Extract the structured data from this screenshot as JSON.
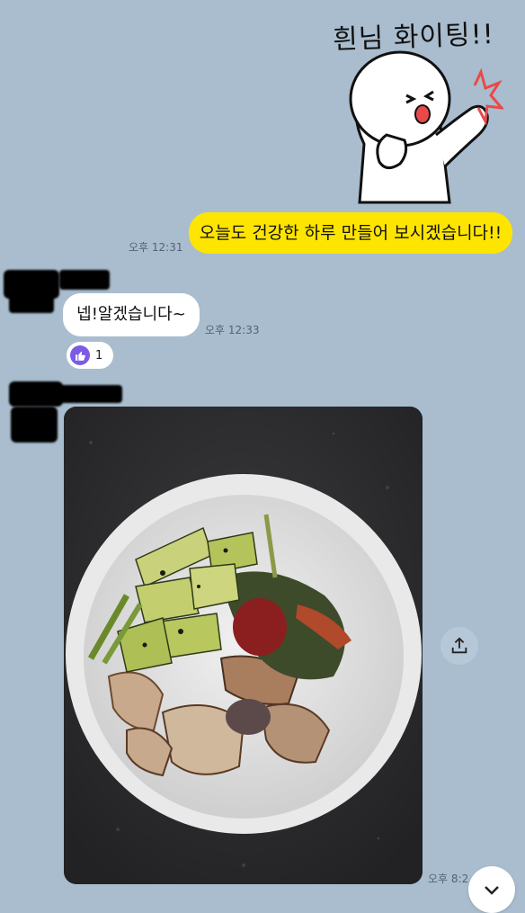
{
  "sticker": {
    "text": "흰님 화이팅!!",
    "icon": "cheering-character-sticker"
  },
  "messages": {
    "outgoing": {
      "text": "오늘도 건강한 하루 만들어 보시겠습니다!!",
      "time": "오후 12:31"
    },
    "incoming_text": {
      "text": "넵!알겠습니다~",
      "time": "오후 12:33",
      "reaction": {
        "icon": "thumbs-up-icon",
        "count": "1",
        "color": "#7c5ce5"
      }
    },
    "incoming_photo": {
      "description_icon": "food-bowl-photo",
      "time": "오후 8:2"
    }
  },
  "controls": {
    "share_icon": "share-icon",
    "scroll_icon": "chevron-down-icon"
  },
  "colors": {
    "background": "#a9bdce",
    "outgoing_bubble": "#fee500",
    "incoming_bubble": "#ffffff"
  }
}
